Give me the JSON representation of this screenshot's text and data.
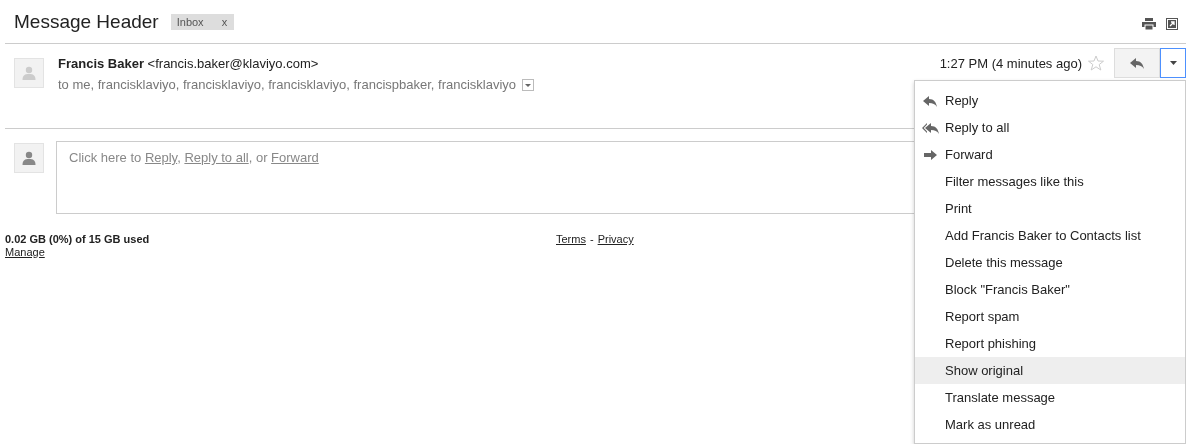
{
  "title": "Message Header",
  "label_chip": {
    "text": "Inbox",
    "close": "x"
  },
  "message": {
    "sender_name": "Francis Baker",
    "sender_email": "<francis.baker@klaviyo.com>",
    "recipients": "to me, francisklaviyo, francisklaviyo, francisklaviyo, francispbaker, francisklaviyo",
    "time": "1:27 PM (4 minutes ago)",
    "starred": false,
    "menu_open": true
  },
  "reply_prompt": [
    {
      "text": "Click here to ",
      "link": false
    },
    {
      "text": "Reply",
      "link": true
    },
    {
      "text": ", ",
      "link": false
    },
    {
      "text": "Reply to all",
      "link": true
    },
    {
      "text": ", or ",
      "link": false
    },
    {
      "text": "Forward",
      "link": true
    }
  ],
  "footer": {
    "storage": "0.02 GB (0%) of 15 GB used",
    "manage": "Manage",
    "terms": "Terms",
    "separator": "-",
    "privacy": "Privacy"
  },
  "menu": [
    {
      "label": "Reply",
      "kind": "reply",
      "selected": false
    },
    {
      "label": "Reply to all",
      "kind": "replyall",
      "selected": false
    },
    {
      "label": "Forward",
      "kind": "forward",
      "selected": false
    },
    {
      "label": "Filter messages like this",
      "kind": "plain",
      "selected": false
    },
    {
      "label": "Print",
      "kind": "plain",
      "selected": false
    },
    {
      "label": "Add Francis Baker to Contacts list",
      "kind": "plain",
      "selected": false
    },
    {
      "label": "Delete this message",
      "kind": "plain",
      "selected": false
    },
    {
      "label": "Block \"Francis Baker\"",
      "kind": "plain",
      "selected": false
    },
    {
      "label": "Report spam",
      "kind": "plain",
      "selected": false
    },
    {
      "label": "Report phishing",
      "kind": "plain",
      "selected": false
    },
    {
      "label": "Show original",
      "kind": "plain",
      "selected": true
    },
    {
      "label": "Translate message",
      "kind": "plain",
      "selected": false
    },
    {
      "label": "Mark as unread",
      "kind": "plain",
      "selected": false
    }
  ]
}
